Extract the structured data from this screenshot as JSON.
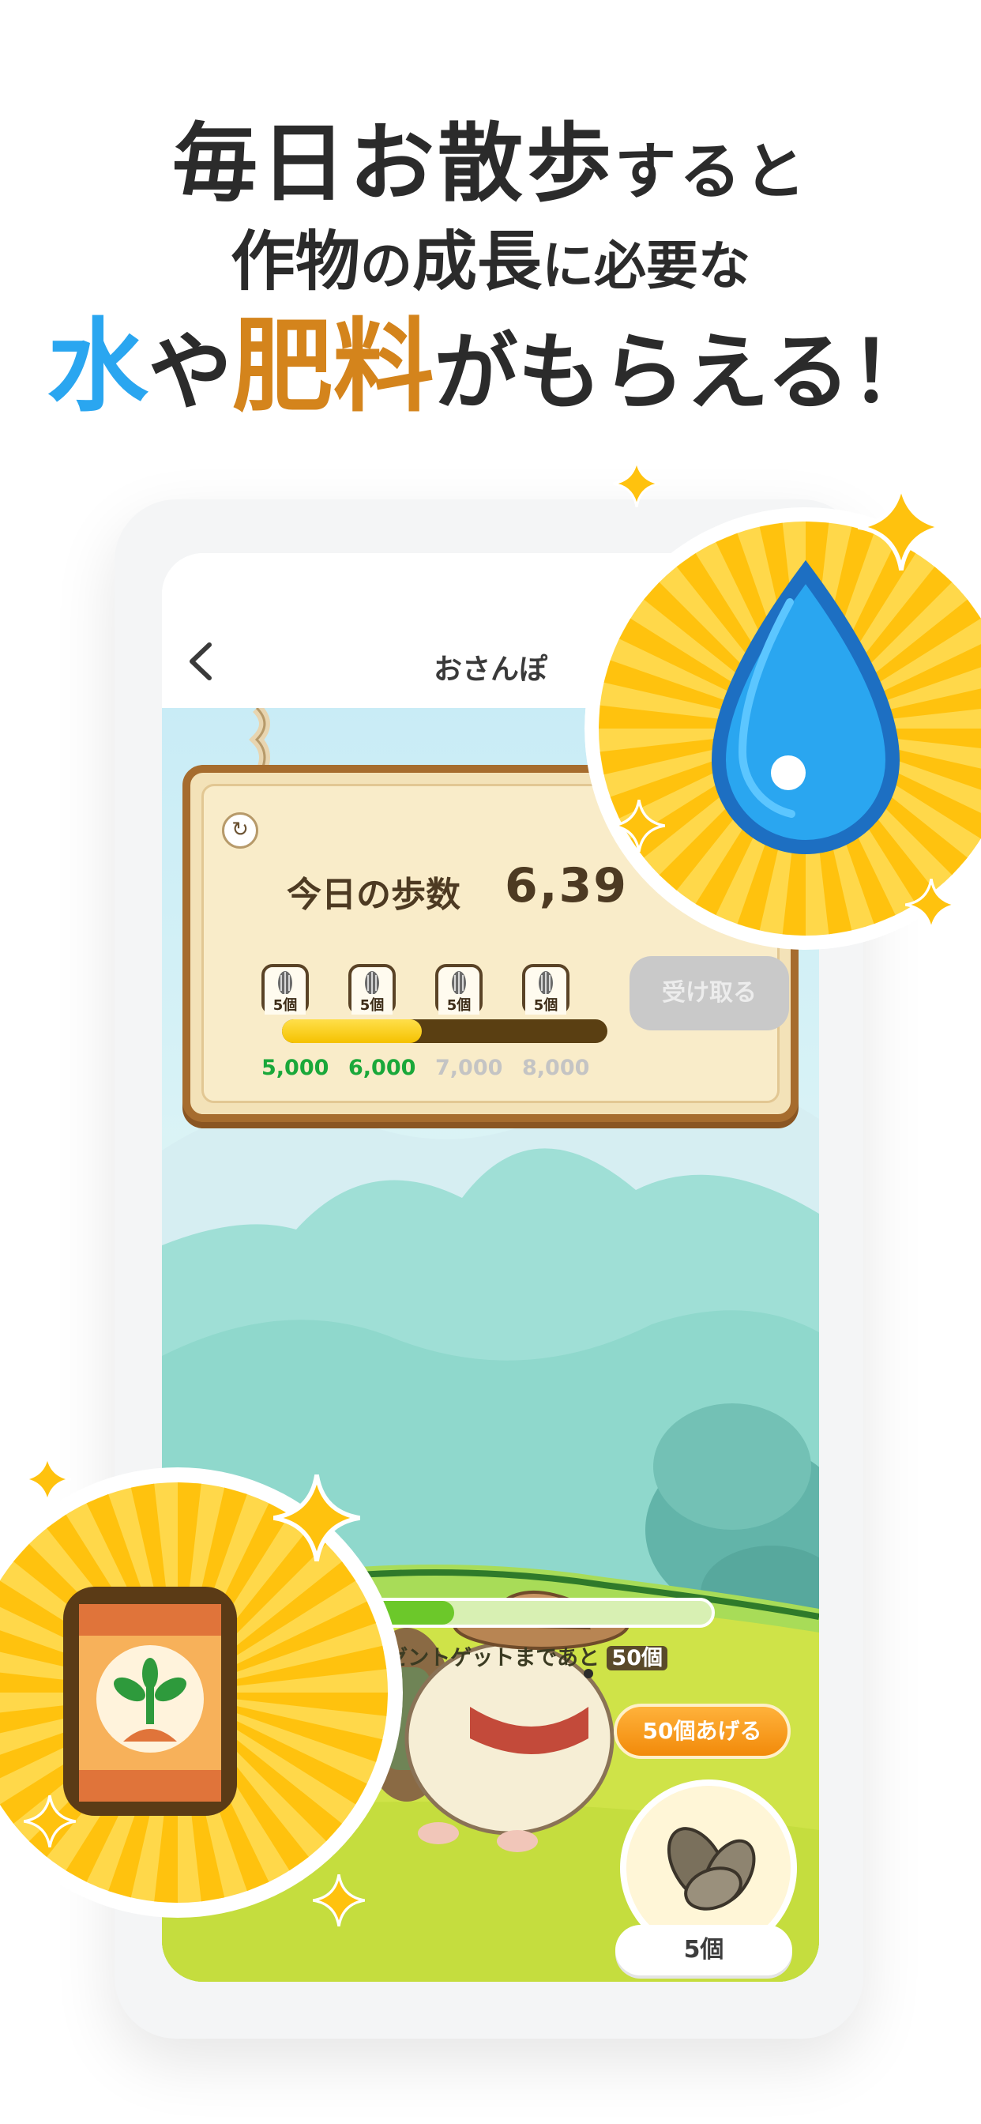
{
  "headline": {
    "line1_big": "毎日お散歩",
    "line1_small": "すると",
    "line2_big_a": "作物",
    "line2_small_a": "の",
    "line2_big_b": "成長",
    "line2_small_b": "に必要な",
    "line3_water": "水",
    "line3_ya": "や",
    "line3_fert": "肥料",
    "line3_rest": "がもらえる！"
  },
  "nav": {
    "title": "おさんぽ"
  },
  "sign": {
    "steps_label": "今日の歩数",
    "steps_value": "6,39",
    "badges": [
      {
        "count": "5個"
      },
      {
        "count": "5個"
      },
      {
        "count": "5個"
      },
      {
        "count": "5個"
      }
    ],
    "ticks": [
      {
        "label": "5,000",
        "color": "#1aa83a"
      },
      {
        "label": "6,000",
        "color": "#1aa83a"
      },
      {
        "label": "7,000",
        "color": "#c4c4c4"
      },
      {
        "label": "8,000",
        "color": "#c4c4c4"
      }
    ],
    "progress_fraction": 0.43,
    "receive_button": "受け取る"
  },
  "present": {
    "text": "レゼントゲットまであと",
    "remaining": "50個",
    "progress_fraction": 0.45
  },
  "give_button": "50個あげる",
  "seed_count": "5個",
  "colors": {
    "water": "#2aa6f0",
    "fertilizer": "#d4841c",
    "burst_yellow": "#ffc20e",
    "tick_done": "#1aa83a",
    "tick_pending": "#c4c4c4"
  },
  "icons": [
    "back-chevron-icon",
    "refresh-icon",
    "sunflower-seed-icon",
    "water-drop-icon",
    "fertilizer-bag-icon",
    "sparkle-icon"
  ]
}
